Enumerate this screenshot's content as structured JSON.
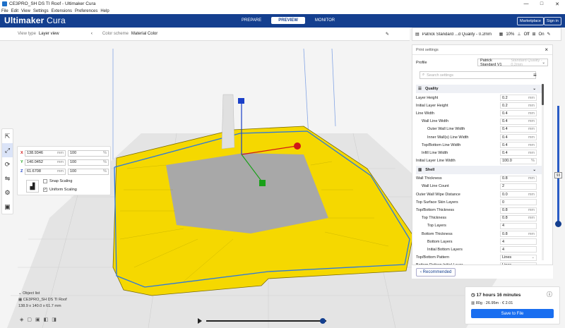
{
  "window": {
    "title": "CE3PRO_SH DS TI Roof - Ultimaker Cura",
    "controls": [
      "—",
      "□",
      "✕"
    ]
  },
  "menu": [
    "File",
    "Edit",
    "View",
    "Settings",
    "Extensions",
    "Preferences",
    "Help"
  ],
  "header": {
    "logo_bold": "Ultimaker",
    "logo_light": " Cura",
    "stages": [
      "PREPARE",
      "PREVIEW",
      "MONITOR"
    ],
    "active_stage": "PREVIEW",
    "marketplace": "Marketplace",
    "signin": "Sign in"
  },
  "viewbar": {
    "view_type_label": "View type",
    "view_type_value": "Layer view",
    "color_scheme_label": "Color scheme",
    "color_scheme_value": "Material Color"
  },
  "printbar": {
    "profile": "Patrick Standard ...d Quality - 0.2mm",
    "infill": "10%",
    "support": "Off",
    "adhesion": "On"
  },
  "scale_panel": {
    "x": {
      "axis": "X",
      "mm": "138.9346",
      "pct": "100"
    },
    "y": {
      "axis": "Y",
      "mm": "140.0452",
      "pct": "100"
    },
    "z": {
      "axis": "Z",
      "mm": "61.6708",
      "pct": "100"
    },
    "unit_mm": "mm",
    "unit_pct": "%",
    "snap_scaling": "Snap Scaling",
    "uniform_scaling": "Uniform Scaling",
    "uniform_checked": true
  },
  "settings": {
    "title": "Print settings",
    "profile_label": "Profile",
    "profile_value": "Patrick Standard V1",
    "profile_hint": "Standard Quality - 0.2mm",
    "search_placeholder": "Search settings",
    "quality_title": "Quality",
    "shell_title": "Shell",
    "quality_rows": [
      {
        "name": "Layer Height",
        "value": "0.2",
        "unit": "mm"
      },
      {
        "name": "Initial Layer Height",
        "value": "0.2",
        "unit": "mm"
      },
      {
        "name": "Line Width",
        "value": "0.4",
        "unit": "mm"
      },
      {
        "name": "Wall Line Width",
        "value": "0.4",
        "unit": "mm"
      },
      {
        "name": "Outer Wall Line Width",
        "value": "0.4",
        "unit": "mm"
      },
      {
        "name": "Inner Wall(s) Line Width",
        "value": "0.4",
        "unit": "mm"
      },
      {
        "name": "Top/Bottom Line Width",
        "value": "0.4",
        "unit": "mm"
      },
      {
        "name": "Infill Line Width",
        "value": "0.4",
        "unit": "mm"
      },
      {
        "name": "Initial Layer Line Width",
        "value": "100.0",
        "unit": "%"
      }
    ],
    "shell_rows": [
      {
        "name": "Wall Thickness",
        "value": "0.8",
        "unit": "mm"
      },
      {
        "name": "Wall Line Count",
        "value": "2",
        "unit": ""
      },
      {
        "name": "Outer Wall Wipe Distance",
        "value": "0.0",
        "unit": "mm"
      },
      {
        "name": "Top Surface Skin Layers",
        "value": "0",
        "unit": ""
      },
      {
        "name": "Top/Bottom Thickness",
        "value": "0.8",
        "unit": "mm"
      },
      {
        "name": "Top Thickness",
        "value": "0.8",
        "unit": "mm"
      },
      {
        "name": "Top Layers",
        "value": "4",
        "unit": ""
      },
      {
        "name": "Bottom Thickness",
        "value": "0.8",
        "unit": "mm"
      },
      {
        "name": "Bottom Layers",
        "value": "4",
        "unit": ""
      },
      {
        "name": "Initial Bottom Layers",
        "value": "4",
        "unit": ""
      },
      {
        "name": "Top/Bottom Pattern",
        "value": "Lines",
        "unit": "⌄"
      },
      {
        "name": "Bottom Pattern Initial Layer",
        "value": "Lines",
        "unit": "⌄"
      }
    ],
    "recommended": "Recommended"
  },
  "layer_slider": {
    "top_value": "93"
  },
  "object_list": {
    "title": "Object list",
    "file": "CE3PRO_SH DS TI Roof",
    "dims": "138.9 x 140.0 x 61.7 mm"
  },
  "job": {
    "time": "17 hours 16 minutes",
    "material": "80g · 26.95m · € 2.01",
    "save": "Save to File"
  },
  "colors": {
    "brand": "#143f8f",
    "accent": "#196ef0",
    "model": "#f5d800"
  }
}
